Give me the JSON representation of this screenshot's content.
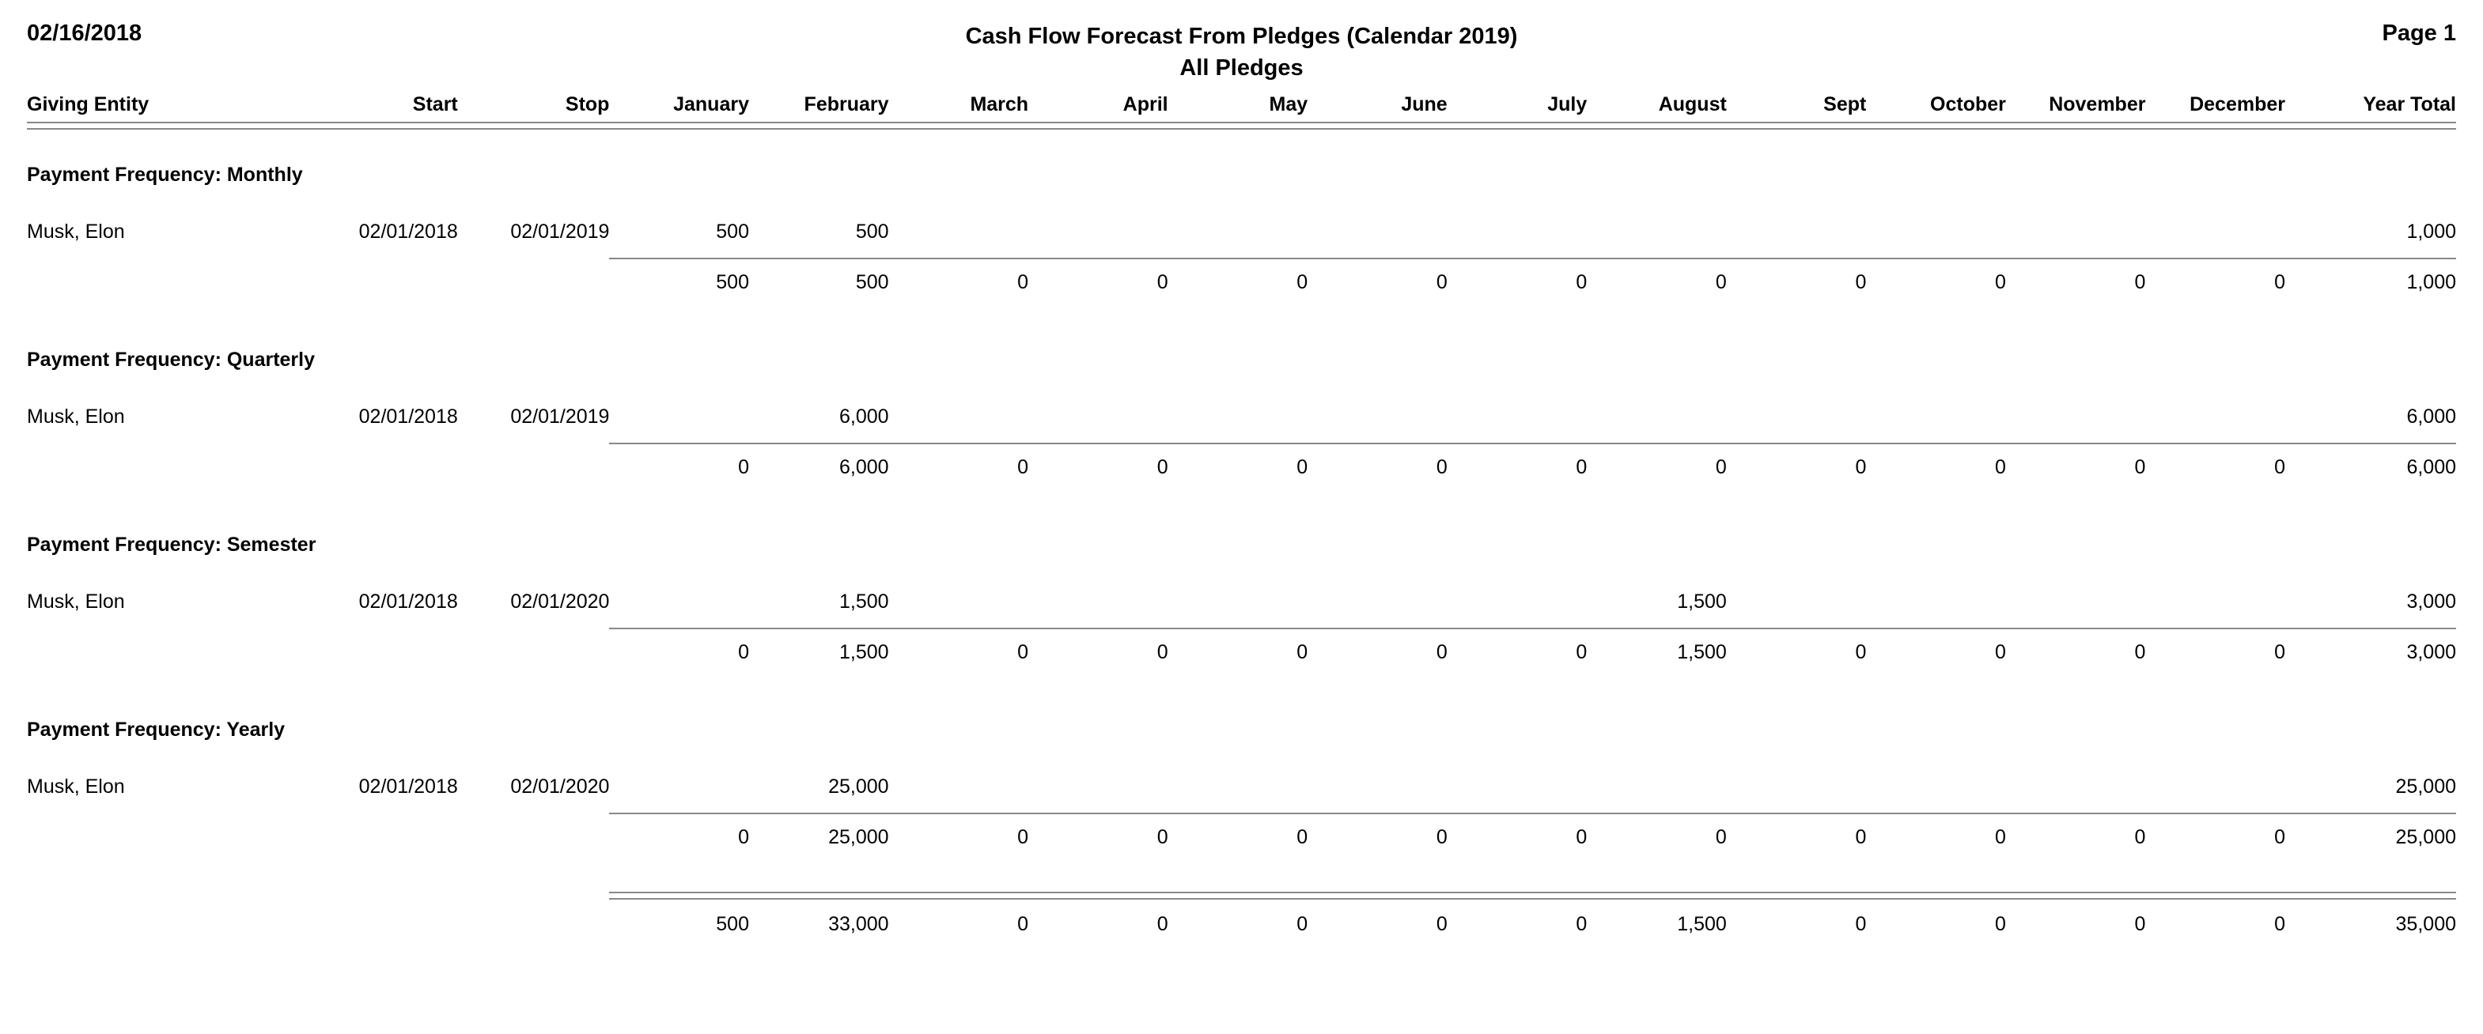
{
  "header": {
    "date": "02/16/2018",
    "title": "Cash Flow Forecast From Pledges (Calendar 2019)",
    "subtitle": "All Pledges",
    "page_label": "Page 1"
  },
  "columns": [
    {
      "key": "entity",
      "label": "Giving Entity",
      "align": "left"
    },
    {
      "key": "start",
      "label": "Start",
      "align": "right"
    },
    {
      "key": "stop",
      "label": "Stop",
      "align": "right"
    },
    {
      "key": "jan",
      "label": "January",
      "align": "right"
    },
    {
      "key": "feb",
      "label": "February",
      "align": "right"
    },
    {
      "key": "mar",
      "label": "March",
      "align": "right"
    },
    {
      "key": "apr",
      "label": "April",
      "align": "right"
    },
    {
      "key": "may",
      "label": "May",
      "align": "right"
    },
    {
      "key": "jun",
      "label": "June",
      "align": "right"
    },
    {
      "key": "jul",
      "label": "July",
      "align": "right"
    },
    {
      "key": "aug",
      "label": "August",
      "align": "right"
    },
    {
      "key": "sept",
      "label": "Sept",
      "align": "right"
    },
    {
      "key": "oct",
      "label": "October",
      "align": "right"
    },
    {
      "key": "nov",
      "label": "November",
      "align": "right"
    },
    {
      "key": "dec",
      "label": "December",
      "align": "right"
    },
    {
      "key": "yeartotal",
      "label": "Year Total",
      "align": "right"
    }
  ],
  "groups": [
    {
      "heading": "Payment Frequency: Monthly",
      "rows": [
        {
          "entity": "Musk, Elon",
          "start": "02/01/2018",
          "stop": "02/01/2019",
          "months": [
            "500",
            "500",
            "",
            "",
            "",
            "",
            "",
            "",
            "",
            "",
            "",
            ""
          ],
          "year_total": "1,000"
        }
      ],
      "subtotal": {
        "months": [
          "500",
          "500",
          "0",
          "0",
          "0",
          "0",
          "0",
          "0",
          "0",
          "0",
          "0",
          "0"
        ],
        "year_total": "1,000"
      }
    },
    {
      "heading": "Payment Frequency: Quarterly",
      "rows": [
        {
          "entity": "Musk, Elon",
          "start": "02/01/2018",
          "stop": "02/01/2019",
          "months": [
            "",
            "6,000",
            "",
            "",
            "",
            "",
            "",
            "",
            "",
            "",
            "",
            ""
          ],
          "year_total": "6,000"
        }
      ],
      "subtotal": {
        "months": [
          "0",
          "6,000",
          "0",
          "0",
          "0",
          "0",
          "0",
          "0",
          "0",
          "0",
          "0",
          "0"
        ],
        "year_total": "6,000"
      }
    },
    {
      "heading": "Payment Frequency: Semester",
      "rows": [
        {
          "entity": "Musk, Elon",
          "start": "02/01/2018",
          "stop": "02/01/2020",
          "months": [
            "",
            "1,500",
            "",
            "",
            "",
            "",
            "",
            "1,500",
            "",
            "",
            "",
            ""
          ],
          "year_total": "3,000"
        }
      ],
      "subtotal": {
        "months": [
          "0",
          "1,500",
          "0",
          "0",
          "0",
          "0",
          "0",
          "1,500",
          "0",
          "0",
          "0",
          "0"
        ],
        "year_total": "3,000"
      }
    },
    {
      "heading": "Payment Frequency: Yearly",
      "rows": [
        {
          "entity": "Musk, Elon",
          "start": "02/01/2018",
          "stop": "02/01/2020",
          "months": [
            "",
            "25,000",
            "",
            "",
            "",
            "",
            "",
            "",
            "",
            "",
            "",
            ""
          ],
          "year_total": "25,000"
        }
      ],
      "subtotal": {
        "months": [
          "0",
          "25,000",
          "0",
          "0",
          "0",
          "0",
          "0",
          "0",
          "0",
          "0",
          "0",
          "0"
        ],
        "year_total": "25,000"
      }
    }
  ],
  "grand_total": {
    "months": [
      "500",
      "33,000",
      "0",
      "0",
      "0",
      "0",
      "0",
      "1,500",
      "0",
      "0",
      "0",
      "0"
    ],
    "year_total": "35,000"
  },
  "colors": {
    "text": "#000000",
    "rule": "#888888",
    "background": "#ffffff"
  }
}
